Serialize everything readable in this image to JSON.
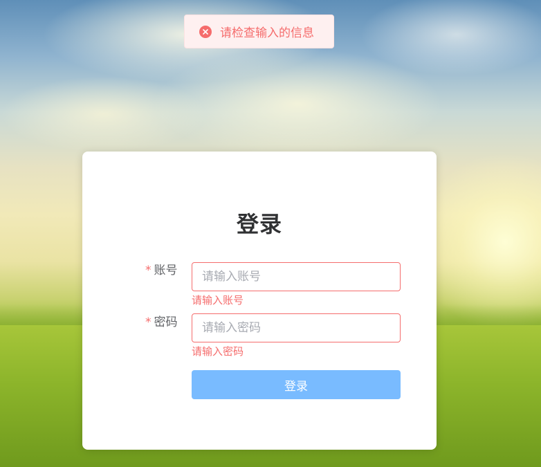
{
  "toast": {
    "message": "请检查输入的信息",
    "icon": "error-circle-icon",
    "color": "#f56c6c"
  },
  "login": {
    "title": "登录",
    "account": {
      "required_mark": "*",
      "label": "账号",
      "placeholder": "请输入账号",
      "value": "",
      "error": "请输入账号"
    },
    "password": {
      "required_mark": "*",
      "label": "密码",
      "placeholder": "请输入密码",
      "value": "",
      "error": "请输入密码"
    },
    "submit_label": "登录"
  },
  "colors": {
    "error": "#f56c6c",
    "primary_disabled": "#79bbff",
    "toast_bg": "#fef0f0"
  }
}
